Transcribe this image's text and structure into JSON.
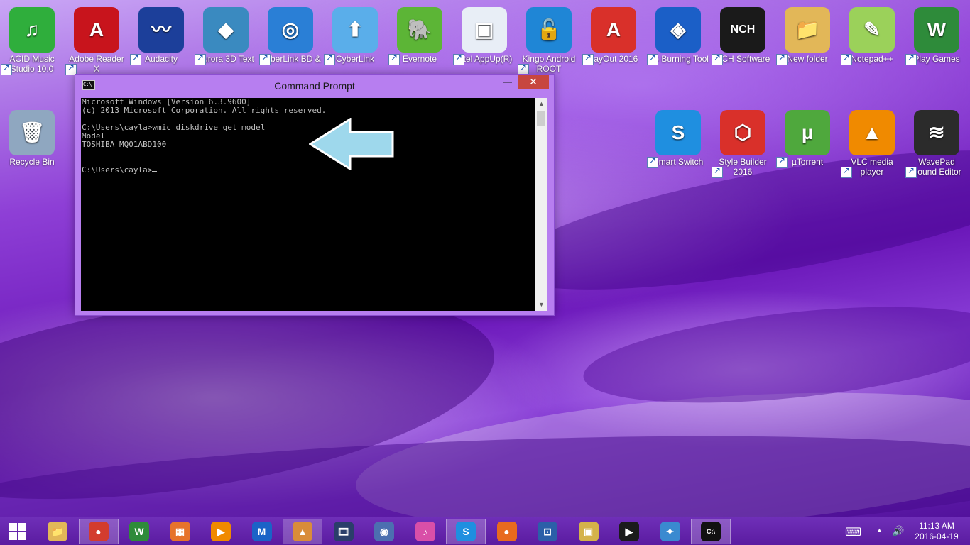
{
  "desktop": {
    "icons": [
      {
        "label": "ACID Music Studio 10.0",
        "glyph": "♫",
        "color": "#2fae3c"
      },
      {
        "label": "Adobe Reader X",
        "glyph": "A",
        "color": "#c8141c"
      },
      {
        "label": "Audacity",
        "glyph": "〰",
        "color": "#1c3f9a"
      },
      {
        "label": "Aurora 3D Text",
        "glyph": "◆",
        "color": "#3a8ac0"
      },
      {
        "label": "CyberLink BD &",
        "glyph": "◎",
        "color": "#2a7fd6"
      },
      {
        "label": "CyberLink",
        "glyph": "⬆",
        "color": "#5aaeea"
      },
      {
        "label": "Evernote",
        "glyph": "🐘",
        "color": "#5cb536"
      },
      {
        "label": "Intel AppUp(R)",
        "glyph": "▣",
        "color": "#e8eef6"
      },
      {
        "label": "Kingo Android ROOT",
        "glyph": "🔓",
        "color": "#1f86d6"
      },
      {
        "label": "LayOut 2016",
        "glyph": "A",
        "color": "#d9302a"
      },
      {
        "label": "LG Burning Tool",
        "glyph": "◈",
        "color": "#1b5fc7"
      },
      {
        "label": "NCH Software",
        "glyph": "NCH",
        "color": "#1a1a1a"
      },
      {
        "label": "New folder",
        "glyph": "📁",
        "color": "#e2b758"
      },
      {
        "label": "Notepad++",
        "glyph": "✎",
        "color": "#9bd15a"
      },
      {
        "label": "Play Games",
        "glyph": "W",
        "color": "#2e8b3a"
      },
      {
        "label": "Recycle Bin",
        "glyph": "🗑",
        "color": "#8fa7c0"
      },
      {
        "label": "Smart Switch",
        "glyph": "S",
        "color": "#1f8fe0"
      },
      {
        "label": "Style Builder 2016",
        "glyph": "⬡",
        "color": "#d9302a"
      },
      {
        "label": "µTorrent",
        "glyph": "µ",
        "color": "#4fa83d"
      },
      {
        "label": "VLC media player",
        "glyph": "▲",
        "color": "#f08a00"
      },
      {
        "label": "WavePad Sound Editor",
        "glyph": "≋",
        "color": "#2b2b2b"
      }
    ]
  },
  "cmd": {
    "title": "Command Prompt",
    "app_icon_text": "C:\\",
    "minimize": "—",
    "maximize": "☐",
    "close": "✕",
    "lines": [
      "Microsoft Windows [Version 6.3.9600]",
      "(c) 2013 Microsoft Corporation. All rights reserved.",
      "",
      "C:\\Users\\cayla>wmic diskdrive get model",
      "Model",
      "TOSHIBA MQ01ABD100",
      "",
      ""
    ],
    "prompt": "C:\\Users\\cayla>",
    "scroll_up": "▲",
    "scroll_down": "▼"
  },
  "taskbar": {
    "start_icon": "windows-logo",
    "items": [
      {
        "name": "file-explorer",
        "glyph": "📁",
        "color": "#e2b758",
        "active": false
      },
      {
        "name": "chrome",
        "glyph": "●",
        "color": "#d33c2e",
        "active": true
      },
      {
        "name": "play-games",
        "glyph": "W",
        "color": "#2e8b3a",
        "active": false
      },
      {
        "name": "app-tiles",
        "glyph": "▦",
        "color": "#e6732b",
        "active": false
      },
      {
        "name": "video-player",
        "glyph": "▶",
        "color": "#f08a00",
        "active": false
      },
      {
        "name": "malwarebytes",
        "glyph": "M",
        "color": "#1a63c7",
        "active": false
      },
      {
        "name": "app-active-2",
        "glyph": "▲",
        "color": "#d98c3a",
        "active": true
      },
      {
        "name": "film-app",
        "glyph": "🎞",
        "color": "#2a3e6a",
        "active": false
      },
      {
        "name": "bird-app",
        "glyph": "◉",
        "color": "#4c6fb0",
        "active": false
      },
      {
        "name": "itunes",
        "glyph": "♪",
        "color": "#d94fa8",
        "active": false
      },
      {
        "name": "skype",
        "glyph": "S",
        "color": "#1f8fe0",
        "active": true
      },
      {
        "name": "firefox",
        "glyph": "●",
        "color": "#e86a1e",
        "active": false
      },
      {
        "name": "remote-desktop",
        "glyph": "⊡",
        "color": "#2b5fa8",
        "active": false
      },
      {
        "name": "cyberlink-app",
        "glyph": "▣",
        "color": "#d4b24a",
        "active": false
      },
      {
        "name": "media-player",
        "glyph": "▶",
        "color": "#1b1b1b",
        "active": false
      },
      {
        "name": "safari",
        "glyph": "✦",
        "color": "#3a8ad0",
        "active": false
      },
      {
        "name": "command-prompt",
        "glyph": "C:\\",
        "color": "#111111",
        "active": true
      }
    ],
    "tray": {
      "keyboard_icon": "⌨",
      "chevron": "▲",
      "volume": "🔊",
      "time": "11:13 AM",
      "date": "2016-04-19"
    }
  }
}
